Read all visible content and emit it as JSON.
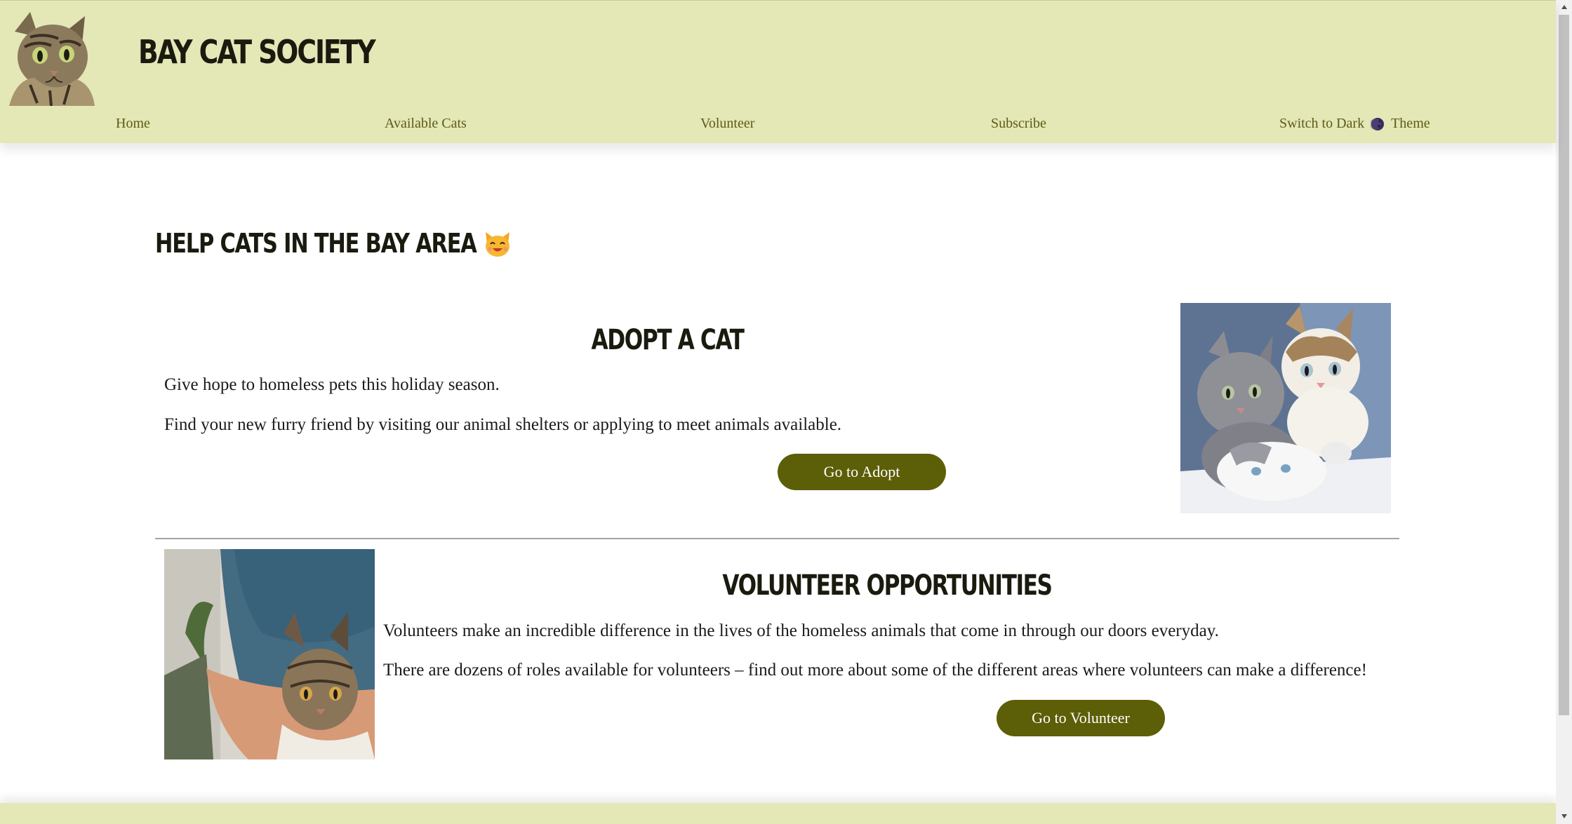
{
  "site": {
    "title": "BAY CAT SOCIETY"
  },
  "nav": {
    "home": "Home",
    "available_cats": "Available Cats",
    "volunteer": "Volunteer",
    "subscribe": "Subscribe",
    "theme_before": "Switch to Dark",
    "theme_after": "Theme"
  },
  "main": {
    "heading": "HELP CATS IN THE BAY AREA"
  },
  "adopt": {
    "title": "ADOPT A CAT",
    "line1": "Give hope to homeless pets this holiday season.",
    "line2": "Find your new furry friend by visiting our animal shelters or applying to meet animals available.",
    "button": "Go to Adopt"
  },
  "volunteer": {
    "title": "VOLUNTEER OPPORTUNITIES",
    "line1": "Volunteers make an incredible difference in the lives of the homeless animals that come in through our doors everyday.",
    "line2": "There are dozens of roles available for volunteers – find out more about some of the different areas where volunteers can make a difference!",
    "button": "Go to Volunteer"
  },
  "icons": {
    "logo": "tabby-cat-logo",
    "theme": "moon-icon",
    "heading_emoji": "smiling-cat-face-icon",
    "adopt_photo": "kittens-photo",
    "volunteer_photo": "person-holding-cat-photo"
  },
  "colors": {
    "header_bg": "#e4e7b6",
    "nav_text": "#5b5c16",
    "button_bg": "#5c5e08",
    "button_text": "#ffffff"
  }
}
